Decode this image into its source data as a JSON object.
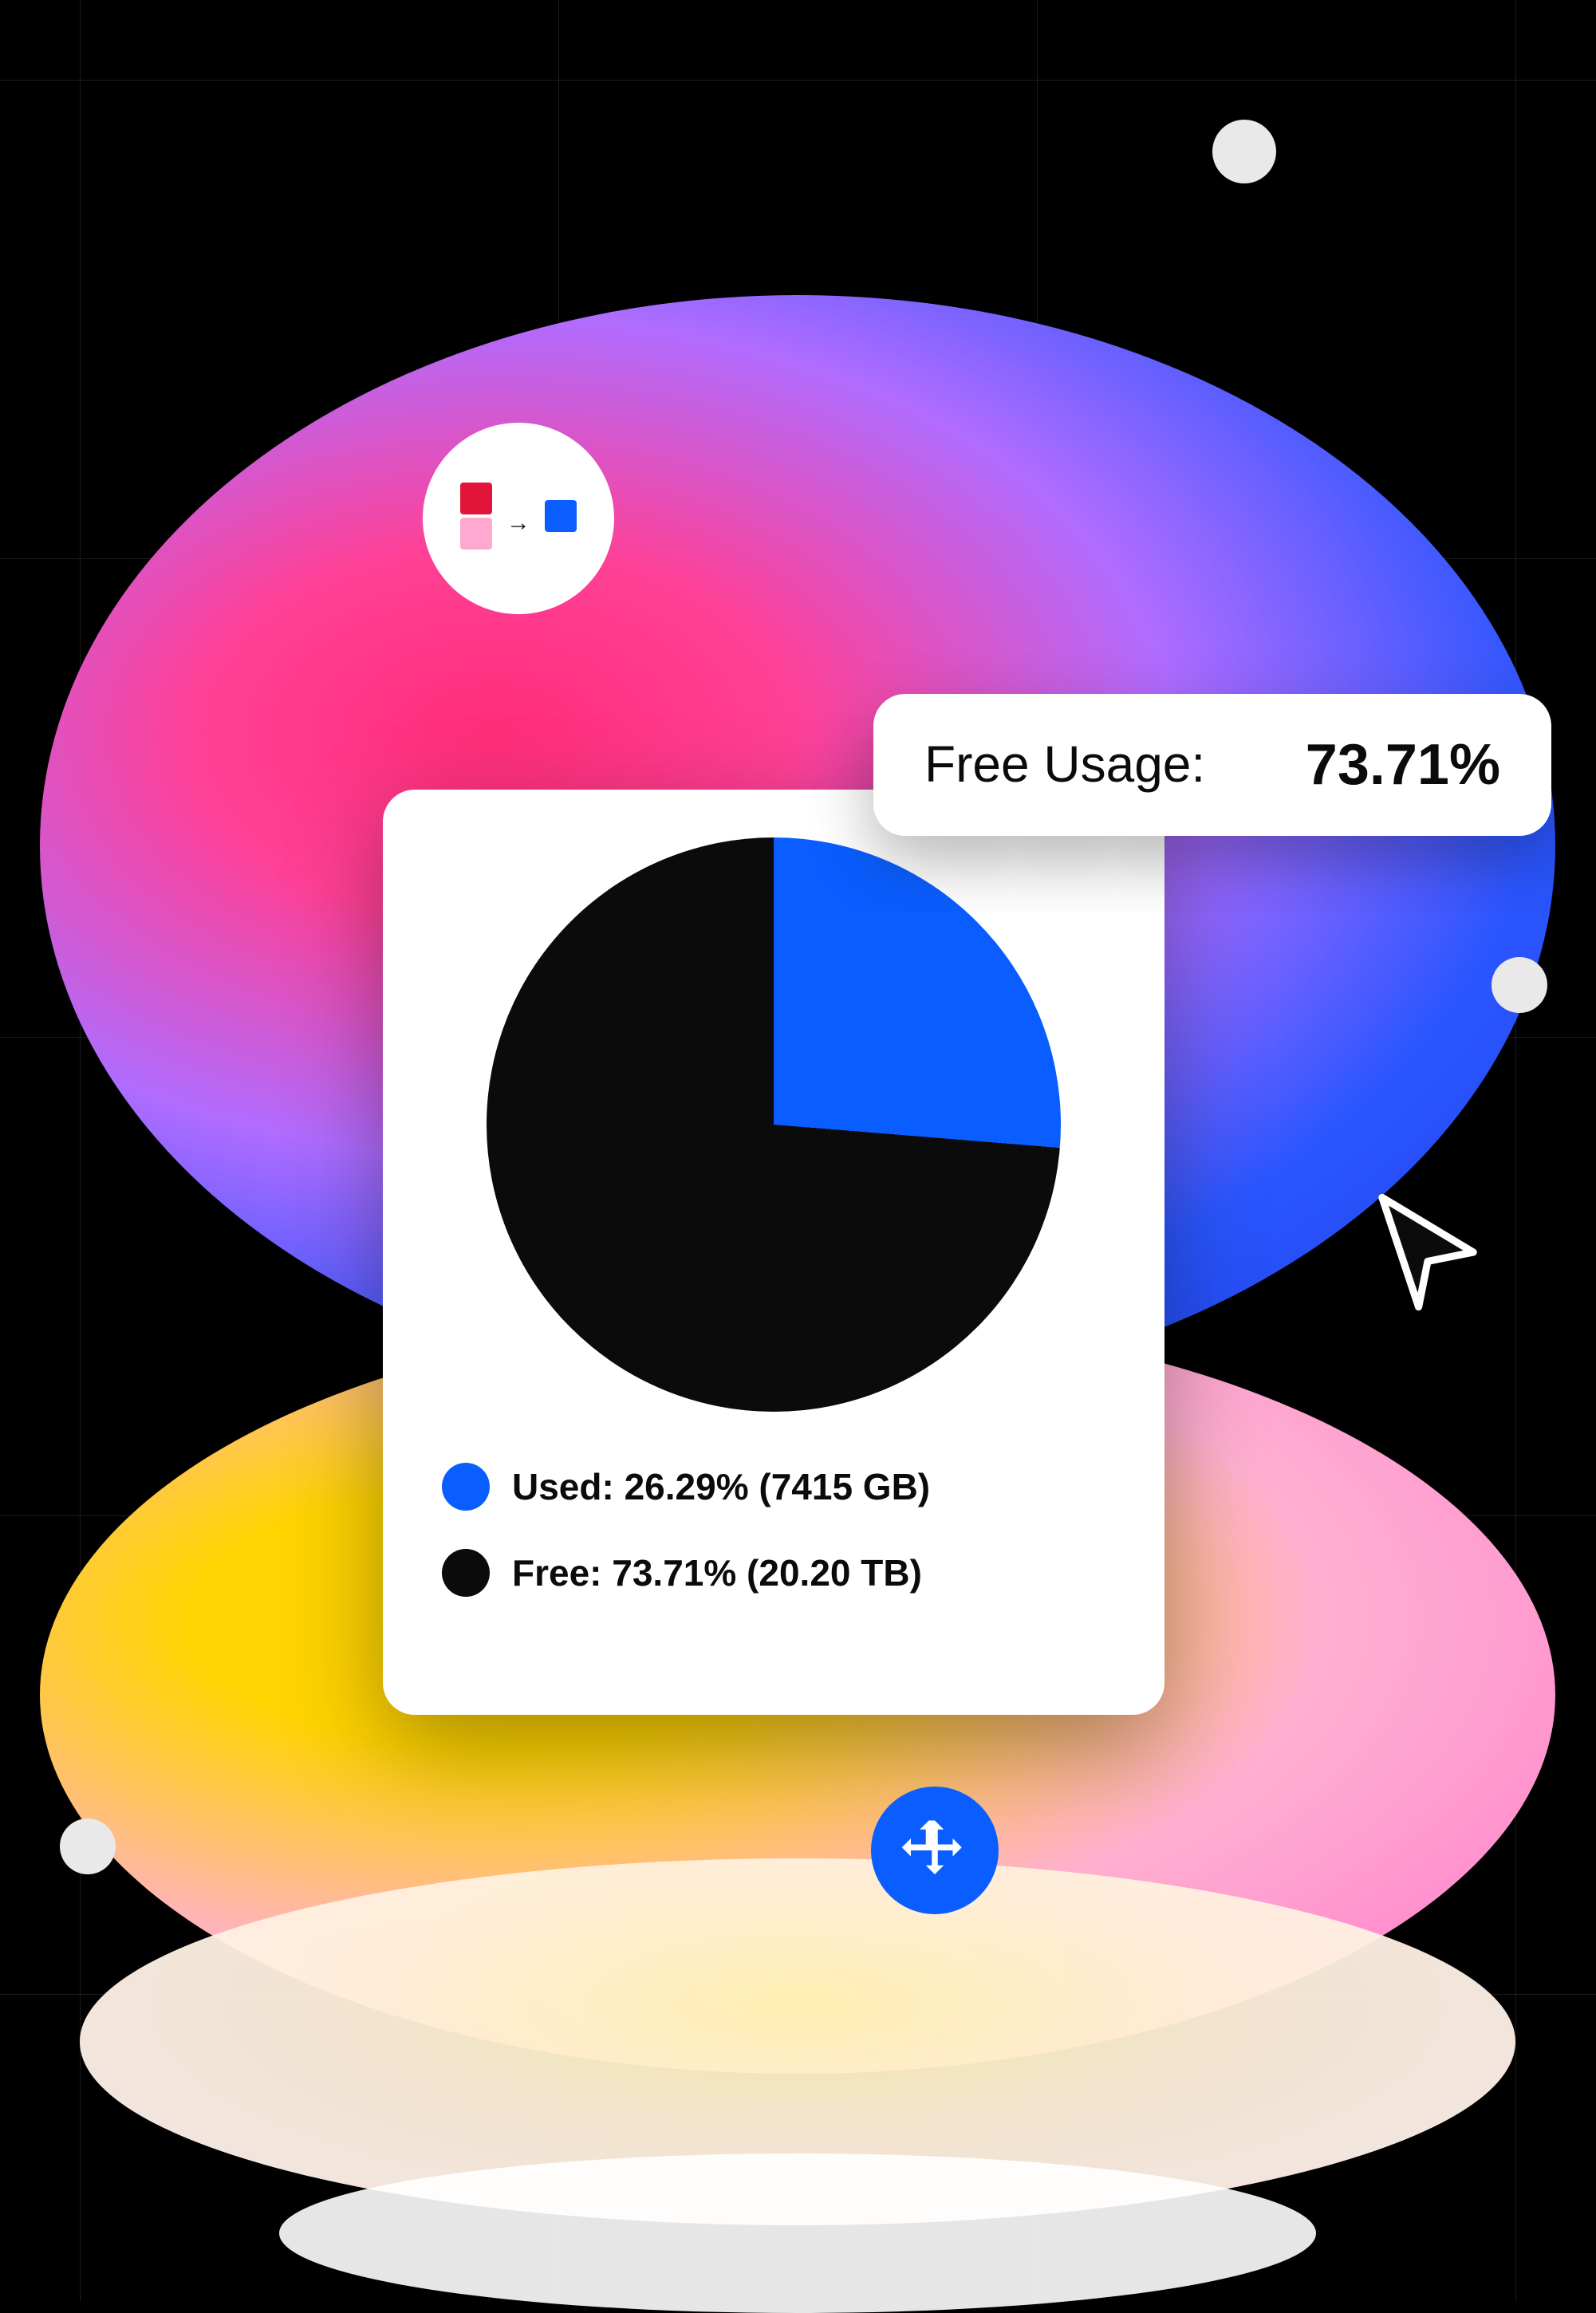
{
  "tooltip": {
    "label": "Free Usage:",
    "value": "73.71%"
  },
  "legend": {
    "used": "Used: 26.29% (7415 GB)",
    "free": "Free: 73.71% (20.20 TB)"
  },
  "colors": {
    "used": "#0a5eff",
    "free": "#0b0b0b",
    "accent_red": "#e3143a",
    "accent_pink": "#ffa8d0"
  },
  "chart_data": {
    "type": "pie",
    "title": "",
    "series": [
      {
        "name": "Used",
        "value": 26.29,
        "unit": "%",
        "size": "7415 GB",
        "color": "#0a5eff"
      },
      {
        "name": "Free",
        "value": 73.71,
        "unit": "%",
        "size": "20.20 TB",
        "color": "#0b0b0b"
      }
    ]
  }
}
